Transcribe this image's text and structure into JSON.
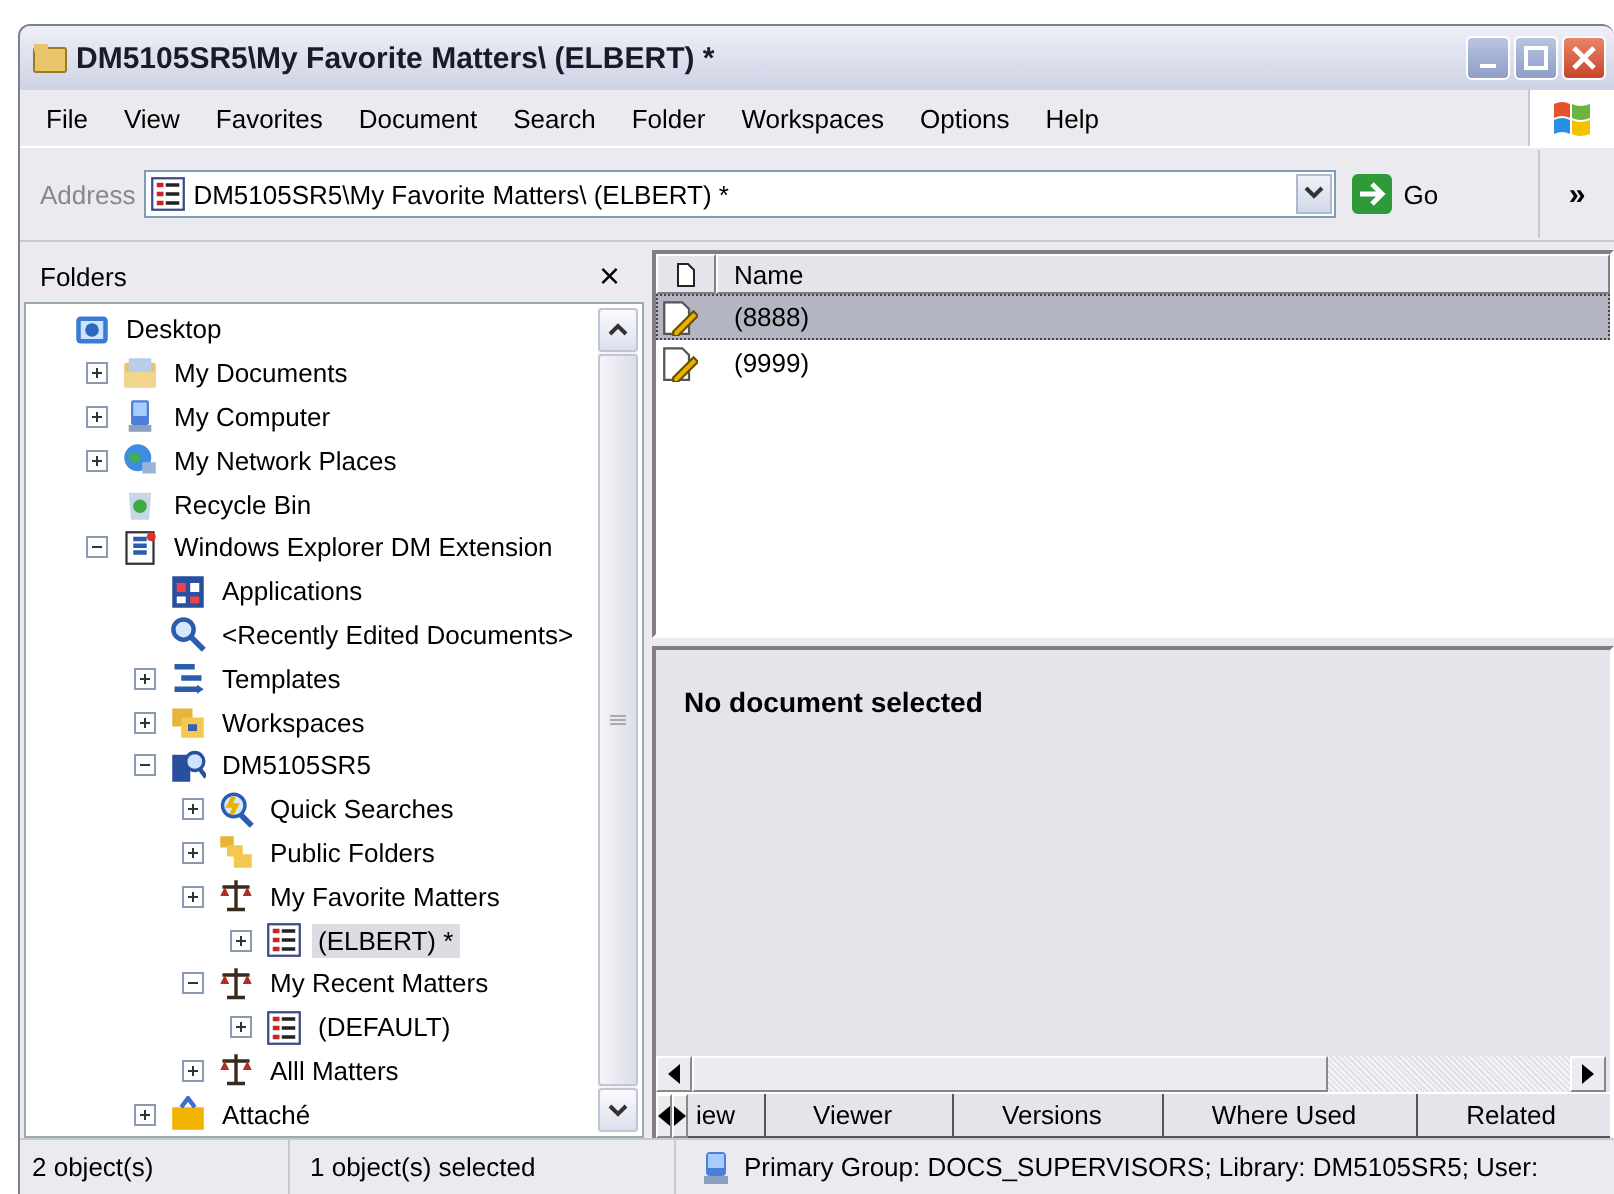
{
  "window": {
    "title": "DM5105SR5\\My Favorite Matters\\ (ELBERT) *"
  },
  "menu": [
    "File",
    "View",
    "Favorites",
    "Document",
    "Search",
    "Folder",
    "Workspaces",
    "Options",
    "Help"
  ],
  "address": {
    "label": "Address",
    "value": "DM5105SR5\\My Favorite Matters\\ (ELBERT) *",
    "go": "Go",
    "more": "»"
  },
  "folders": {
    "title": "Folders",
    "close": "×",
    "tree": [
      {
        "label": "Desktop",
        "kind": "desktop",
        "selected": false,
        "children": [
          {
            "label": "My Documents",
            "kind": "documents",
            "expanded": false,
            "selected": false
          },
          {
            "label": "My Computer",
            "kind": "computer",
            "expanded": false,
            "selected": false
          },
          {
            "label": "My Network Places",
            "kind": "network",
            "expanded": false,
            "selected": false
          },
          {
            "label": "Recycle Bin",
            "kind": "recycle",
            "selected": false
          },
          {
            "label": "Windows Explorer DM Extension",
            "kind": "extension",
            "expanded": true,
            "selected": false,
            "children": [
              {
                "label": "Applications",
                "kind": "applications",
                "selected": false
              },
              {
                "label": "<Recently Edited Documents>",
                "kind": "search",
                "selected": false
              },
              {
                "label": "Templates",
                "kind": "templates",
                "expanded": false,
                "selected": false
              },
              {
                "label": "Workspaces",
                "kind": "workspaces",
                "expanded": false,
                "selected": false
              },
              {
                "label": "DM5105SR5",
                "kind": "library",
                "expanded": true,
                "selected": false,
                "children": [
                  {
                    "label": "Quick Searches",
                    "kind": "quick-search",
                    "expanded": false,
                    "selected": false
                  },
                  {
                    "label": "Public Folders",
                    "kind": "public-folders",
                    "expanded": false,
                    "selected": false
                  },
                  {
                    "label": "My Favorite Matters",
                    "kind": "matters",
                    "expanded": false,
                    "selected": false,
                    "children": [
                      {
                        "label": "(ELBERT) *",
                        "kind": "matter-list",
                        "expanded": false,
                        "selected": true
                      }
                    ]
                  },
                  {
                    "label": "My Recent Matters",
                    "kind": "matters",
                    "expanded": true,
                    "selected": false,
                    "children": [
                      {
                        "label": "(DEFAULT)",
                        "kind": "matter-list",
                        "expanded": false,
                        "selected": false
                      }
                    ]
                  },
                  {
                    "label": "Alll Matters",
                    "kind": "matters",
                    "expanded": false,
                    "selected": false
                  }
                ]
              },
              {
                "label": "Attaché",
                "kind": "attache",
                "expanded": false,
                "selected": false
              }
            ]
          }
        ]
      }
    ]
  },
  "list": {
    "column": "Name",
    "rows": [
      {
        "name": "(8888)",
        "selected": true
      },
      {
        "name": "(9999)",
        "selected": false
      }
    ]
  },
  "preview": {
    "message": "No document selected"
  },
  "tabs": [
    "iew",
    "Viewer",
    "Versions",
    "Where Used",
    "Related"
  ],
  "status_bar": {
    "count": "2 object(s)",
    "selection": "1 object(s) selected",
    "info": "Primary Group: DOCS_SUPERVISORS;  Library: DM5105SR5;  User:"
  }
}
